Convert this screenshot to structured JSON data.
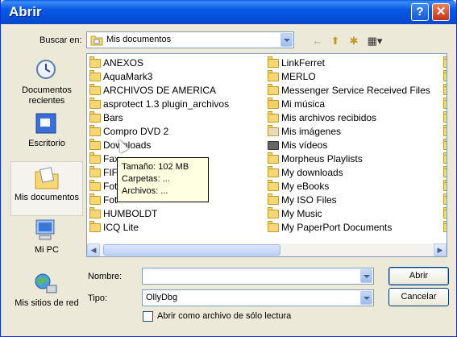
{
  "window": {
    "title": "Abrir",
    "help_glyph": "?",
    "close_glyph": "✕"
  },
  "lookin": {
    "label": "Buscar en:",
    "value": "Mis documentos"
  },
  "toolbar": {
    "back_glyph": "←",
    "up_glyph": "⬆",
    "newfolder_glyph": "✱",
    "views_glyph": "▦▾"
  },
  "places": [
    {
      "label": "Documentos recientes"
    },
    {
      "label": "Escritorio"
    },
    {
      "label": "Mis documentos"
    },
    {
      "label": "Mi PC"
    },
    {
      "label": "Mis sitios de red"
    }
  ],
  "files_col1": [
    "ANEXOS",
    "AquaMark3",
    "ARCHIVOS DE AMERICA",
    "asprotect 1.3 plugin_archivos",
    "Bars",
    "Compro DVD 2",
    "Downloads",
    "Fax",
    "FIF",
    "Fot",
    "Fot",
    "HUMBOLDT",
    "ICQ Lite"
  ],
  "files_col2": [
    "LinkFerret",
    "MERLO",
    "Messenger Service Received Files",
    "Mi música",
    "Mis archivos recibidos",
    "Mis imágenes",
    "Mis vídeos",
    "Morpheus Playlists",
    "My downloads",
    "My eBooks",
    "My ISO Files",
    "My Music",
    "My PaperPort Documents"
  ],
  "tooltip": {
    "line1": "Tamaño: 102 MB",
    "line2": "Carpetas: ...",
    "line3": "Archivos: ..."
  },
  "form": {
    "name_label": "Nombre:",
    "name_value": "",
    "type_label": "Tipo:",
    "type_value": "OllyDbg",
    "readonly_label": "Abrir como archivo de sólo lectura",
    "open_button": "Abrir",
    "cancel_button": "Cancelar"
  }
}
